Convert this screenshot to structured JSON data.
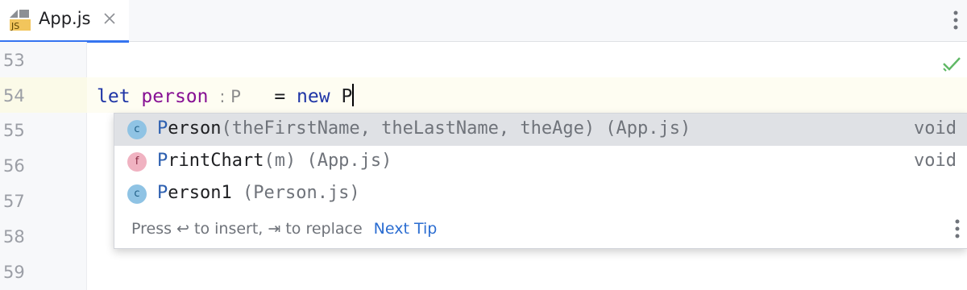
{
  "tab": {
    "label": "App.js",
    "icon": "js-file-icon",
    "icon_text": "JS"
  },
  "gutter": {
    "lines": [
      "53",
      "54",
      "55",
      "56",
      "57",
      "58",
      "59"
    ]
  },
  "editor": {
    "keyword_let": "let",
    "variable": "person",
    "type_hint": ": P",
    "equals": "=",
    "keyword_new": "new",
    "typed": "P"
  },
  "completion": {
    "items": [
      {
        "icon": "c",
        "icon_name": "class-icon",
        "match": "P",
        "rest": "erson",
        "params": "(theFirstName, theLastName, theAge) (App.js)",
        "type": "void"
      },
      {
        "icon": "f",
        "icon_name": "function-icon",
        "match": "P",
        "rest": "rintChart",
        "params": "(m) (App.js)",
        "type": "void"
      },
      {
        "icon": "c",
        "icon_name": "class-icon",
        "match": "P",
        "rest": "erson1",
        "params": " (Person.js)",
        "type": ""
      }
    ],
    "footer_text": "Press ↩ to insert, ⇥ to replace",
    "next_tip": "Next Tip"
  },
  "colors": {
    "accent": "#3574f0",
    "keyword": "#1f35a6",
    "variable": "#871094",
    "match": "#2c5fb0"
  }
}
